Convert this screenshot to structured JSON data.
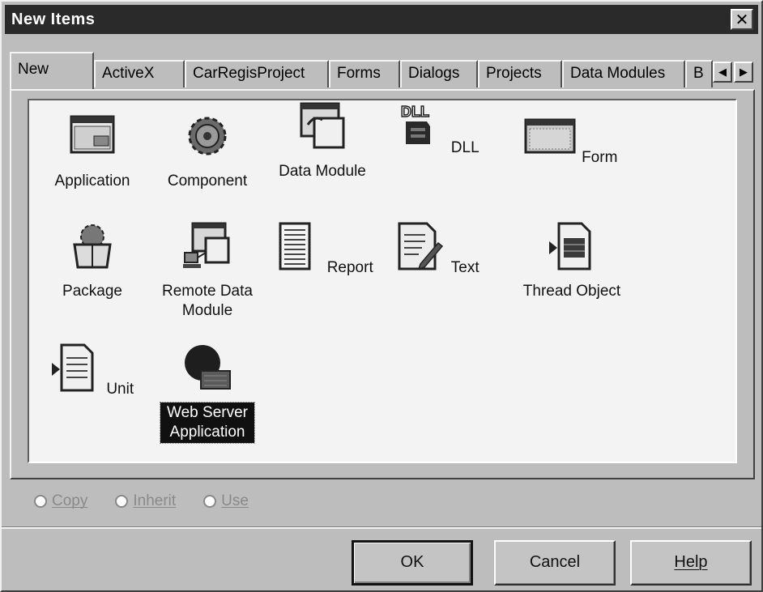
{
  "window": {
    "title": "New Items",
    "close_glyph": "✕"
  },
  "tabs": [
    {
      "label": "New",
      "active": true
    },
    {
      "label": "ActiveX"
    },
    {
      "label": "CarRegisProject"
    },
    {
      "label": "Forms"
    },
    {
      "label": "Dialogs"
    },
    {
      "label": "Projects"
    },
    {
      "label": "Data Modules"
    },
    {
      "label": "B"
    }
  ],
  "tab_scroll": {
    "left": "◀",
    "right": "▶"
  },
  "items": [
    {
      "label": "Application",
      "icon": "application-icon"
    },
    {
      "label": "Component",
      "icon": "component-icon"
    },
    {
      "label": "Data Module",
      "icon": "data-module-icon"
    },
    {
      "label": "DLL",
      "icon": "dll-icon"
    },
    {
      "label": "Form",
      "icon": "form-icon"
    },
    {
      "label": "Package",
      "icon": "package-icon"
    },
    {
      "label": "Remote Data Module",
      "icon": "remote-data-module-icon"
    },
    {
      "label": "Report",
      "icon": "report-icon"
    },
    {
      "label": "Text",
      "icon": "text-icon"
    },
    {
      "label": "Thread Object",
      "icon": "thread-object-icon"
    },
    {
      "label": "Unit",
      "icon": "unit-icon"
    },
    {
      "label": "Web Server Application",
      "icon": "web-server-application-icon",
      "selected": true
    }
  ],
  "options": [
    {
      "label": "Copy",
      "enabled": false
    },
    {
      "label": "Inherit",
      "enabled": false
    },
    {
      "label": "Use",
      "enabled": false
    }
  ],
  "buttons": {
    "ok": "OK",
    "cancel": "Cancel",
    "help": "Help"
  }
}
